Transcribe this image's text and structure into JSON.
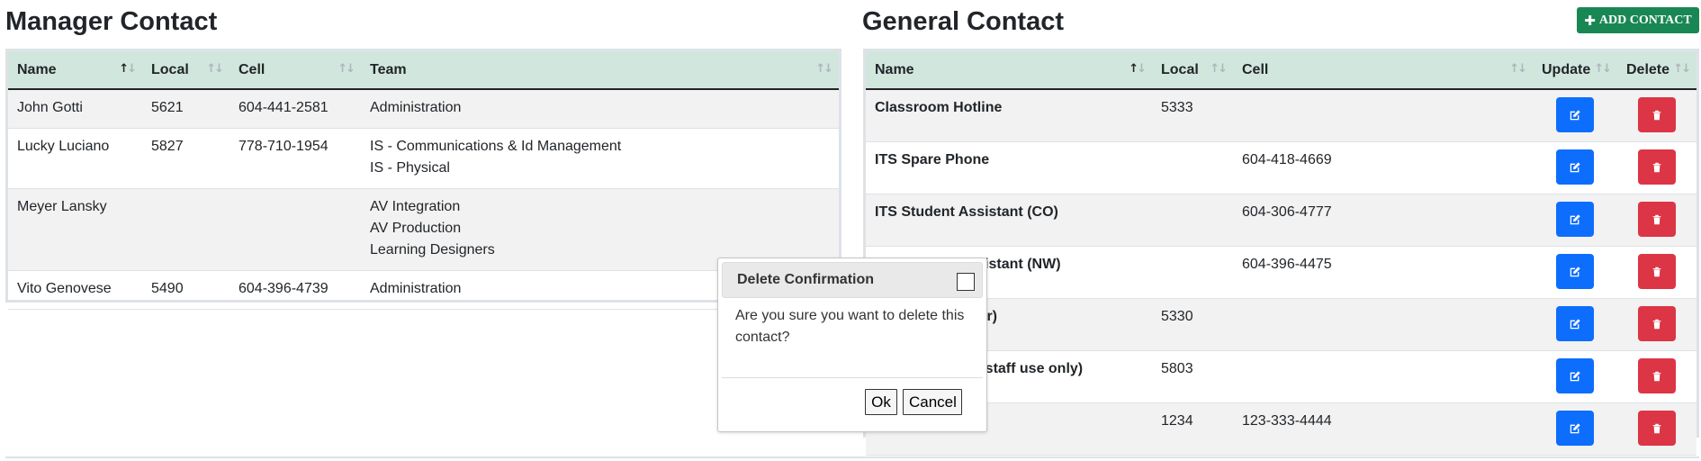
{
  "manager": {
    "title": "Manager Contact",
    "headers": [
      "Name",
      "Local",
      "Cell",
      "Team"
    ],
    "rows": [
      {
        "name": "John Gotti",
        "local": "5621",
        "cell": "604-441-2581",
        "teams": [
          "Administration"
        ]
      },
      {
        "name": "Lucky Luciano",
        "local": "5827",
        "cell": "778-710-1954",
        "teams": [
          "IS - Communications & Id Management",
          "IS - Physical"
        ]
      },
      {
        "name": "Meyer Lansky",
        "local": "",
        "cell": "",
        "teams": [
          "AV Integration",
          "AV Production",
          "Learning Designers"
        ]
      },
      {
        "name": "Vito Genovese",
        "local": "5490",
        "cell": "604-396-4739",
        "teams": [
          "Administration"
        ]
      }
    ]
  },
  "general": {
    "title": "General Contact",
    "add_button": "ADD CONTACT",
    "headers": [
      "Name",
      "Local",
      "Cell",
      "Update",
      "Delete"
    ],
    "rows": [
      {
        "name": "Classroom Hotline",
        "local": "5333",
        "cell": ""
      },
      {
        "name": "ITS Spare Phone",
        "local": "",
        "cell": "604-418-4669"
      },
      {
        "name": "ITS Student Assistant (CO)",
        "local": "",
        "cell": "604-306-4777"
      },
      {
        "name": "ITS Student Assistant (NW)",
        "local": "",
        "cell": "604-396-4475"
      },
      {
        "name": "ITS Main Number)",
        "local": "5330",
        "cell": ""
      },
      {
        "name": "ITS Hotline (ITS staff use only)",
        "local": "5803",
        "cell": ""
      },
      {
        "name": "",
        "local": "1234",
        "cell": "123-333-4444"
      }
    ]
  },
  "dialog": {
    "title": "Delete Confirmation",
    "message": "Are you sure you want to delete this contact?",
    "ok_label": "Ok",
    "cancel_label": "Cancel"
  },
  "icons": {
    "sort": "sort-arrows-icon",
    "edit": "pencil-square-icon",
    "delete": "trash-icon",
    "add": "plus-icon",
    "close": "close-icon"
  },
  "colors": {
    "header_bg": "#d1e7dd",
    "add_button": "#198754",
    "edit_button": "#0d6efd",
    "delete_button": "#dc3545",
    "striped_row": "#f2f2f2"
  }
}
